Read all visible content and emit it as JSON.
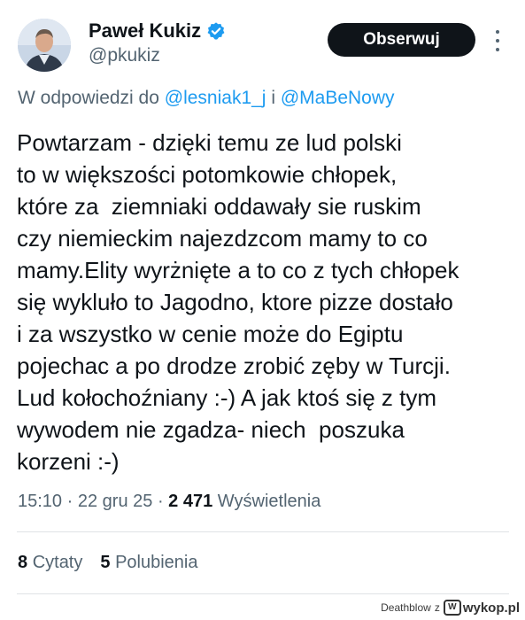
{
  "author": {
    "name": "Paweł Kukiz",
    "handle": "@pkukiz",
    "verified": true,
    "avatar_icon": "avatar-photo"
  },
  "follow_label": "Obserwuj",
  "reply": {
    "prefix": "W odpowiedzi do",
    "mention1": "@lesniak1_j",
    "joiner": "i",
    "mention2": "@MaBeNowy"
  },
  "tweet": {
    "lines": [
      "Powtarzam - dzięki temu ze lud polski",
      "to w większości potomkowie chłopek,",
      "które za  ziemniaki oddawały sie ruskim",
      "czy niemieckim najezdzcom mamy to co",
      "mamy.Elity wyrżnięte a to co z tych chłopek",
      "się wykluło to Jagodno, ktore pizze dostało",
      "i za wszystko w cenie może do Egiptu",
      "pojechac a po drodze zrobić zęby w Turcji.",
      "Lud kołochoźniany :-) A jak ktoś się z tym",
      "wywodem nie zgadza- niech  poszuka",
      "korzeni :-)"
    ]
  },
  "meta": {
    "time": "15:10",
    "sep": "·",
    "date": "22 gru 25",
    "views_count": "2 471",
    "views_label": "Wyświetlenia"
  },
  "stats": {
    "quotes_count": "8",
    "quotes_label": "Cytaty",
    "likes_count": "5",
    "likes_label": "Polubienia"
  },
  "watermark": {
    "user": "Deathblow",
    "z": "z",
    "site": "wykop.pl"
  },
  "colors": {
    "accent": "#1d9bf0",
    "text": "#0f1419",
    "muted": "#536471",
    "button": "#0f1419"
  }
}
